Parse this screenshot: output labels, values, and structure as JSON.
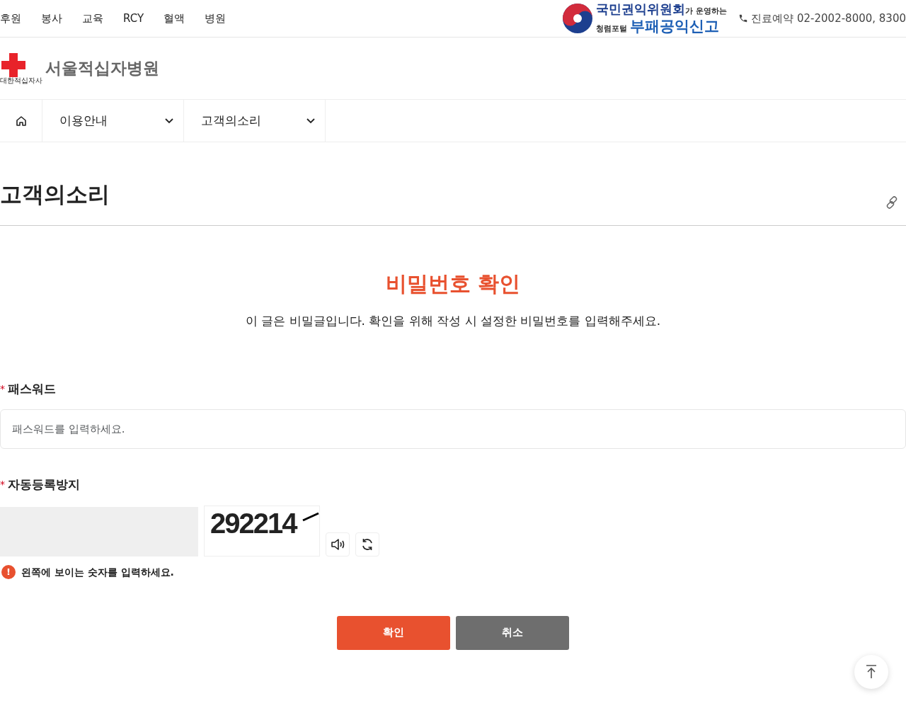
{
  "top_menu": [
    "후원",
    "봉사",
    "교육",
    "RCY",
    "혈액",
    "병원"
  ],
  "banner": {
    "line1": "국민권익위원회",
    "line1_small": "가 운영하는",
    "line2_small": "청렴포털",
    "line2": "부패공익신고"
  },
  "phone": "진료예약 02-2002-8000, 8300",
  "logo": {
    "name": "서울적십자병원",
    "org": "대한적십자사"
  },
  "breadcrumb": [
    {
      "label": "이용안내"
    },
    {
      "label": "고객의소리"
    }
  ],
  "page_title": "고객의소리",
  "heading": "비밀번호 확인",
  "description": "이 글은 비밀글입니다. 확인을 위해 작성 시 설정한 비밀번호를 입력해주세요.",
  "password": {
    "required_mark": "*",
    "label": "패스워드",
    "placeholder": "패스워드를 입력하세요."
  },
  "captcha": {
    "required_mark": "*",
    "label": "자동등록방지",
    "code": "292214",
    "hint_icon": "!",
    "hint": "왼쪽에 보이는 숫자를 입력하세요."
  },
  "buttons": [
    {
      "label": "확인",
      "kind": "primary"
    },
    {
      "label": "취소",
      "kind": "secondary"
    }
  ]
}
